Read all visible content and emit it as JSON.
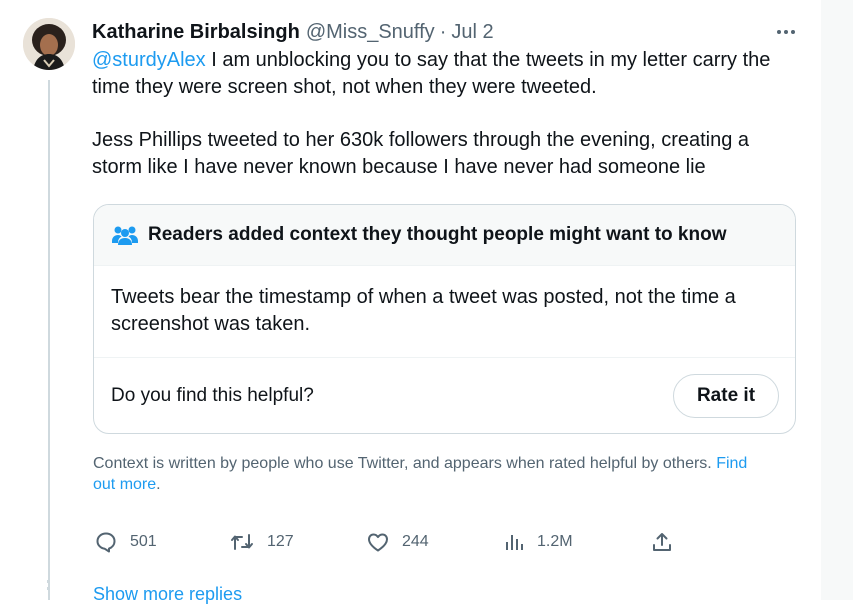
{
  "tweet": {
    "author_name": "Katharine Birbalsingh",
    "handle": "@Miss_Snuffy",
    "separator": "·",
    "date": "Jul 2",
    "mention": "@sturdyAlex",
    "paragraph1_rest": " I am unblocking you to say that the tweets in my letter carry the time they were screen shot, not when they were tweeted.",
    "paragraph2": "Jess Phillips tweeted to her 630k followers through the evening, creating a storm like I have never known because I have never had someone lie"
  },
  "community_note": {
    "icon": "readers-group-icon",
    "heading": "Readers added context they thought people might want to know",
    "body": "Tweets bear the timestamp of when a tweet was posted, not the time a screenshot was taken.",
    "helpful_question": "Do you find this helpful?",
    "rate_label": "Rate it",
    "disclaimer": "Context is written by people who use Twitter, and appears when rated helpful by others.",
    "find_out_more": "Find out more",
    "period": "."
  },
  "metrics": {
    "replies": "501",
    "retweets": "127",
    "likes": "244",
    "views": "1.2M"
  },
  "show_more_replies": "Show more replies",
  "colors": {
    "accent": "#1d9bf0",
    "secondary_text": "#536471",
    "border": "#cfd9de",
    "note_header_bg": "#f7f9f9"
  }
}
